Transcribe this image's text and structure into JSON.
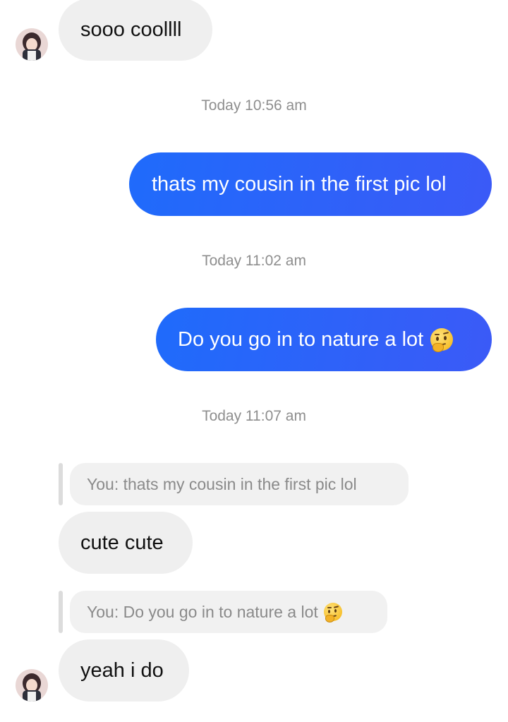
{
  "messages": [
    {
      "type": "incoming",
      "text": "sooo coollll"
    },
    {
      "type": "timestamp",
      "text": "Today 10:56 am"
    },
    {
      "type": "outgoing",
      "text": "thats my cousin in the first pic lol"
    },
    {
      "type": "timestamp",
      "text": "Today 11:02 am"
    },
    {
      "type": "outgoing",
      "text": "Do you go in to nature a lot",
      "emoji": "thinking-face"
    },
    {
      "type": "timestamp",
      "text": "Today 11:07 am"
    },
    {
      "type": "reply",
      "quote": "You: thats my cousin in the first pic lol",
      "text": "cute cute"
    },
    {
      "type": "reply",
      "quote": "You: Do you go in to nature a lot",
      "quote_emoji": "thinking-face",
      "text": "yeah i do"
    }
  ],
  "colors": {
    "outgoing_bubble": "#2b63f9",
    "incoming_bubble": "#efefef",
    "timestamp": "#8e8e8e",
    "reply_text": "#8a8a8a"
  },
  "icons": {
    "avatar": "contact-avatar",
    "emoji": "thinking-face-emoji"
  }
}
